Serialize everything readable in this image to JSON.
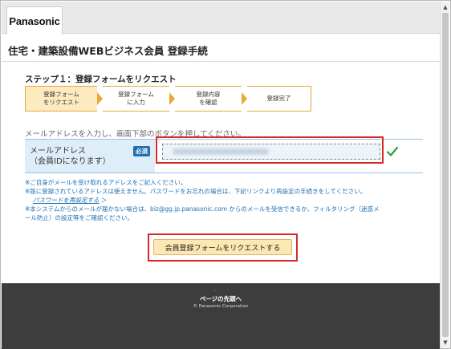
{
  "header": {
    "logo": "Panasonic"
  },
  "page": {
    "title": "住宅・建築設備WEBビジネス会員 登録手続"
  },
  "steps": {
    "heading": "ステップ１：登録フォームをリクエスト",
    "items": [
      {
        "line1": "登録フォーム",
        "line2": "をリクエスト"
      },
      {
        "line1": "登録フォーム",
        "line2": "に入力"
      },
      {
        "line1": "登録内容",
        "line2": "を確認"
      },
      {
        "line1": "登録完了",
        "line2": ""
      }
    ]
  },
  "form": {
    "instruction": "メールアドレスを入力し、画面下部のボタンを押してください。",
    "label_line1": "メールアドレス",
    "label_line2": "（会員IDになります）",
    "required": "必須",
    "email_value": ""
  },
  "notes": {
    "line1": "※ご自身がメールを受け取れるアドレスをご記入ください。",
    "line2": "※既に登録されているアドレスは使えません。パスワードをお忘れの場合は、下記リンクより再設定の手続きをしてください。",
    "link": "パスワードを再設定する",
    "link_arrow": "＞",
    "line3": "※本システムからのメールが届かない場合は、biz@gg.jp.panasonic.com からのメールを受信できるか、フィルタリング（迷惑メ",
    "line4": "ール防止）の設定等をご確認ください。"
  },
  "submit": {
    "label": "会員登録フォームをリクエストする"
  },
  "footer": {
    "caret": "＾",
    "page_top": "ページの先頭へ",
    "copyright": "© Panasonic Corporation"
  }
}
